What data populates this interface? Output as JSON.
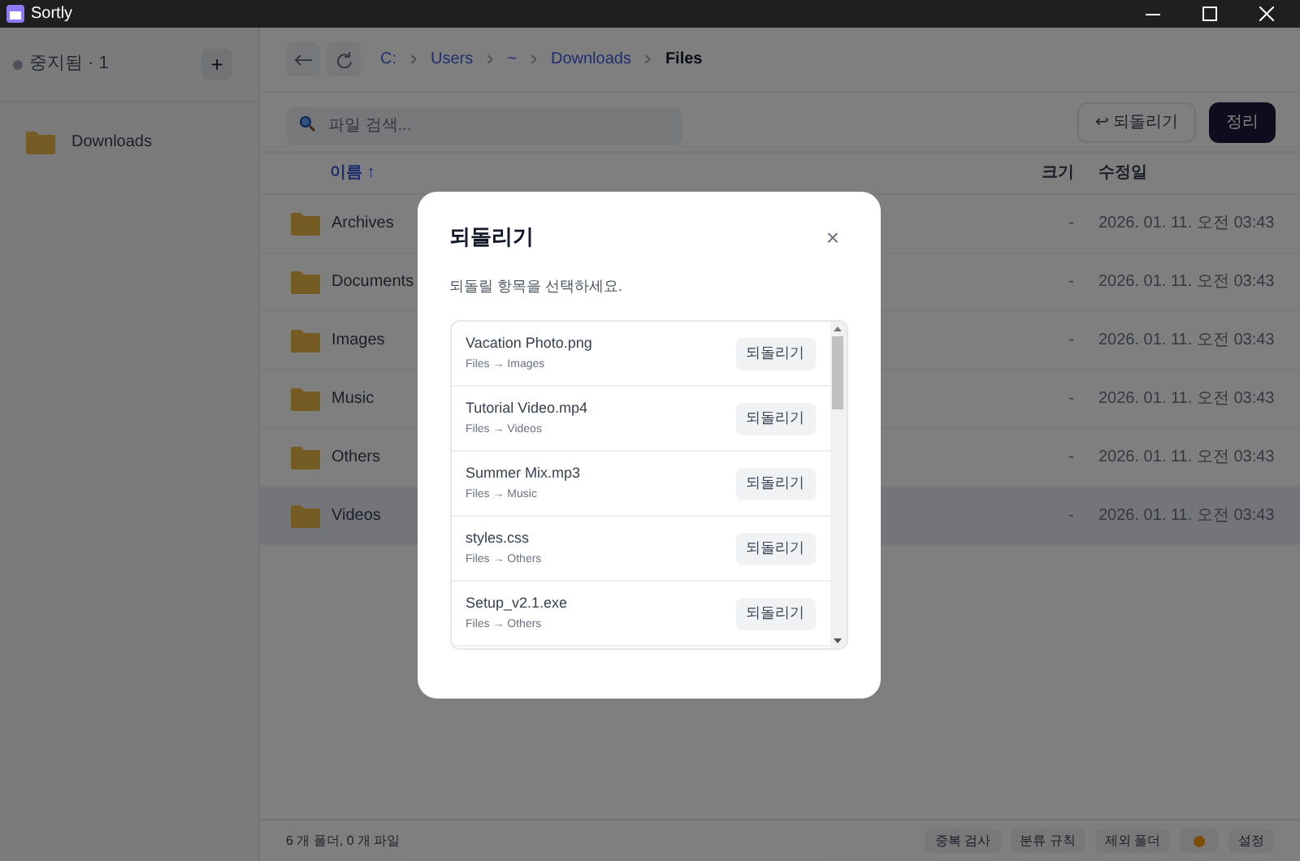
{
  "window": {
    "title": "Sortly"
  },
  "sidebar": {
    "status": "중지됨 · 1",
    "running": false,
    "add": "+",
    "folders": [
      {
        "name": "Downloads",
        "selected": false
      }
    ]
  },
  "breadcrumb": [
    {
      "label": "C:",
      "current": false
    },
    {
      "label": "Users",
      "current": false
    },
    {
      "label": "~",
      "current": false
    },
    {
      "label": "Downloads",
      "current": false
    },
    {
      "label": "Files",
      "current": true
    }
  ],
  "search": {
    "placeholder": "파일 검색..."
  },
  "actions": {
    "undo": "↩ 되돌리기",
    "organize": "정리"
  },
  "table": {
    "columns": [
      {
        "label": "이름 ↑",
        "sorted": true
      },
      {
        "label": "크기",
        "sorted": false
      },
      {
        "label": "수정일",
        "sorted": false
      }
    ],
    "rows": [
      {
        "name": "Archives",
        "size": "-",
        "modified": "2026. 01. 11. 오전 03:43",
        "selected": false
      },
      {
        "name": "Documents",
        "size": "-",
        "modified": "2026. 01. 11. 오전 03:43",
        "selected": false
      },
      {
        "name": "Images",
        "size": "-",
        "modified": "2026. 01. 11. 오전 03:43",
        "selected": false
      },
      {
        "name": "Music",
        "size": "-",
        "modified": "2026. 01. 11. 오전 03:43",
        "selected": false
      },
      {
        "name": "Others",
        "size": "-",
        "modified": "2026. 01. 11. 오전 03:43",
        "selected": false
      },
      {
        "name": "Videos",
        "size": "-",
        "modified": "2026. 01. 11. 오전 03:43",
        "selected": true
      }
    ]
  },
  "status_bar": {
    "summary": "6 개 폴더, 0 개 파일",
    "buttons": [
      "중복 검사",
      "분류 규칙",
      "제외 폴더"
    ],
    "settings": "설정"
  },
  "dialog": {
    "title": "되돌리기",
    "close": "×",
    "message": "되돌릴 항목을 선택하세요.",
    "items": [
      {
        "name": "Vacation Photo.png",
        "path": "Files → Images",
        "action": "되돌리기"
      },
      {
        "name": "Tutorial Video.mp4",
        "path": "Files → Videos",
        "action": "되돌리기"
      },
      {
        "name": "Summer Mix.mp3",
        "path": "Files → Music",
        "action": "되돌리기"
      },
      {
        "name": "styles.css",
        "path": "Files → Others",
        "action": "되돌리기"
      },
      {
        "name": "Setup_v2.1.exe",
        "path": "Files → Others",
        "action": "되돌리기"
      }
    ]
  }
}
